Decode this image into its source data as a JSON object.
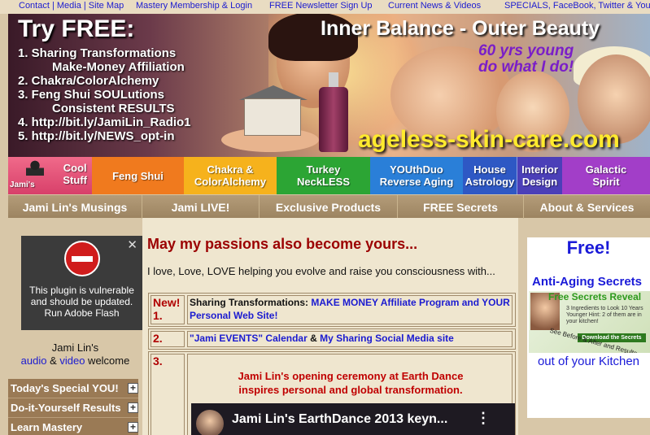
{
  "top_links": {
    "contact": "Contact | Media | Site Map",
    "membership": "Mastery Membership & Login",
    "newsletter": "FREE Newsletter Sign Up",
    "news": "Current News & Videos",
    "specials": "SPECIALS, FaceBook, Twitter & YouTube"
  },
  "banner": {
    "title": "Try FREE:",
    "list": [
      "1. Sharing Transformations",
      "Make-Money Affiliation",
      "2. Chakra/ColorAlchemy",
      "3. Feng Shui SOULutions",
      "Consistent RESULTS",
      "4. http://bit.ly/JamiLin_Radio1",
      "5. http://bit.ly/NEWS_opt-in"
    ],
    "tagline": "Inner Balance - Outer Beauty",
    "years_line1": "60 yrs young",
    "years_line2": "do what I do!",
    "domain": "ageless-skin-care.com"
  },
  "nav": {
    "logo_label": "Cool\nStuff",
    "logo_word": "Jami's",
    "items": [
      {
        "label": "Feng Shui",
        "color": "#f07a1e"
      },
      {
        "label": "Chakra &\nColorAlchemy",
        "color": "#f6b21c"
      },
      {
        "label": "Turkey\nNeckLESS",
        "color": "#2ca534"
      },
      {
        "label": "YOUthDuo\nReverse Aging",
        "color": "#2a7fd8"
      },
      {
        "label": "House\nAstrology",
        "color": "#2e58c4"
      },
      {
        "label": "Interior\nDesign",
        "color": "#4b3fb8"
      },
      {
        "label": "Galactic\nSpirit",
        "color": "#a23ec8"
      }
    ]
  },
  "subnav": [
    "Jami Lin's Musings",
    "Jami LIVE!",
    "Exclusive Products",
    "FREE Secrets",
    "About & Services"
  ],
  "plugin": {
    "message": "This plugin is vulnerable and should be updated. Run Adobe Flash",
    "close": "✕"
  },
  "bio": {
    "name": "Jami Lin's",
    "audio": "audio",
    "amp": " & ",
    "video": "video",
    "welcome": " welcome"
  },
  "sidemenu": [
    "Today's Special YOU!",
    "Do-it-Yourself Results",
    "Learn Mastery"
  ],
  "main": {
    "heading": "May my passions also become yours...",
    "intro": "I love, Love, LOVE helping you evolve and raise you consciousness with...",
    "rows": [
      {
        "num": "New! 1.",
        "text_prefix": "Sharing Transformations: ",
        "link1": "MAKE MONEY Affiliate Program and YOUR Personal Web Site!"
      },
      {
        "num": "2.",
        "link1": "\"Jami EVENTS\" Calendar",
        "mid": " & ",
        "link2": "My Sharing Social Media site"
      },
      {
        "num": "3.",
        "event_line1": "Jami Lin's opening ceremony at Earth Dance",
        "event_line2": "inspires personal and global transformation.",
        "video_title": "Jami Lin's EarthDance 2013 keyn..."
      }
    ]
  },
  "ad": {
    "free": "Free!",
    "title": "Anti-Aging Secrets",
    "reveal": "Free Secrets Reveal",
    "img_lines": "3 Ingredients to Look 10 Years Younger Hint: 2 of them are in your kitchen!",
    "download": "Download the Secrets",
    "diag": "See Before & After and Results",
    "kitchen": "out of your Kitchen"
  }
}
